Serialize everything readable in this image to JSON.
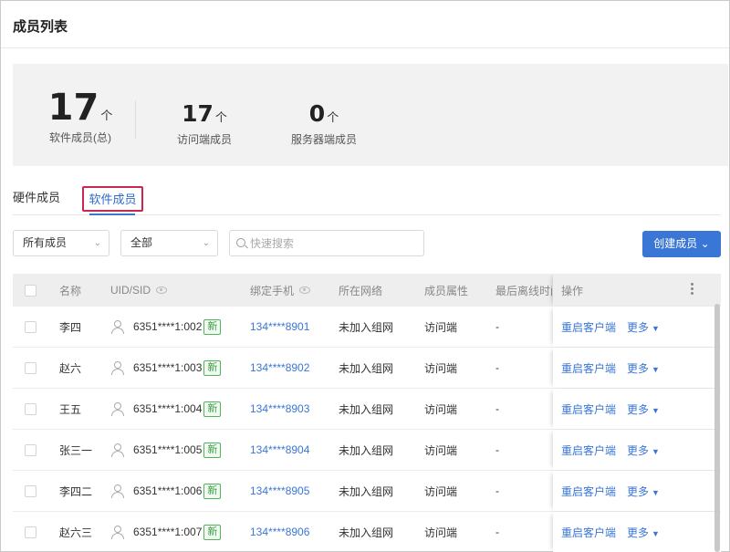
{
  "page_title": "成员列表",
  "stats": {
    "total": {
      "count": "17",
      "unit": "个",
      "label": "软件成员(总)"
    },
    "access": {
      "count": "17",
      "unit": "个",
      "label": "访问端成员"
    },
    "server": {
      "count": "0",
      "unit": "个",
      "label": "服务器端成员"
    }
  },
  "tabs": {
    "hardware": "硬件成员",
    "software": "软件成员"
  },
  "filters": {
    "members": {
      "value": "所有成员"
    },
    "status": {
      "value": "全部"
    },
    "search": {
      "placeholder": "快速搜索"
    },
    "create_button": "创建成员"
  },
  "table": {
    "headers": {
      "name": "名称",
      "uid": "UID/SID",
      "phone": "绑定手机",
      "network": "所在网络",
      "attribute": "成员属性",
      "last_offline": "最后离线时间",
      "actions": "操作"
    },
    "rows": [
      {
        "name": "李四",
        "uid": "6351****1:002",
        "badge": "新",
        "phone": "134****8901",
        "network": "未加入组网",
        "attribute": "访问端",
        "last_offline": "-",
        "restart": "重启客户端",
        "more": "更多"
      },
      {
        "name": "赵六",
        "uid": "6351****1:003",
        "badge": "新",
        "phone": "134****8902",
        "network": "未加入组网",
        "attribute": "访问端",
        "last_offline": "-",
        "restart": "重启客户端",
        "more": "更多"
      },
      {
        "name": "王五",
        "uid": "6351****1:004",
        "badge": "新",
        "phone": "134****8903",
        "network": "未加入组网",
        "attribute": "访问端",
        "last_offline": "-",
        "restart": "重启客户端",
        "more": "更多"
      },
      {
        "name": "张三一",
        "uid": "6351****1:005",
        "badge": "新",
        "phone": "134****8904",
        "network": "未加入组网",
        "attribute": "访问端",
        "last_offline": "-",
        "restart": "重启客户端",
        "more": "更多"
      },
      {
        "name": "李四二",
        "uid": "6351****1:006",
        "badge": "新",
        "phone": "134****8905",
        "network": "未加入组网",
        "attribute": "访问端",
        "last_offline": "-",
        "restart": "重启客户端",
        "more": "更多"
      },
      {
        "name": "赵六三",
        "uid": "6351****1:007",
        "badge": "新",
        "phone": "134****8906",
        "network": "未加入组网",
        "attribute": "访问端",
        "last_offline": "-",
        "restart": "重启客户端",
        "more": "更多"
      }
    ]
  },
  "colors": {
    "accent": "#3a76d6",
    "badge_green": "#52b35c",
    "tab_highlight": "#c8284f"
  }
}
